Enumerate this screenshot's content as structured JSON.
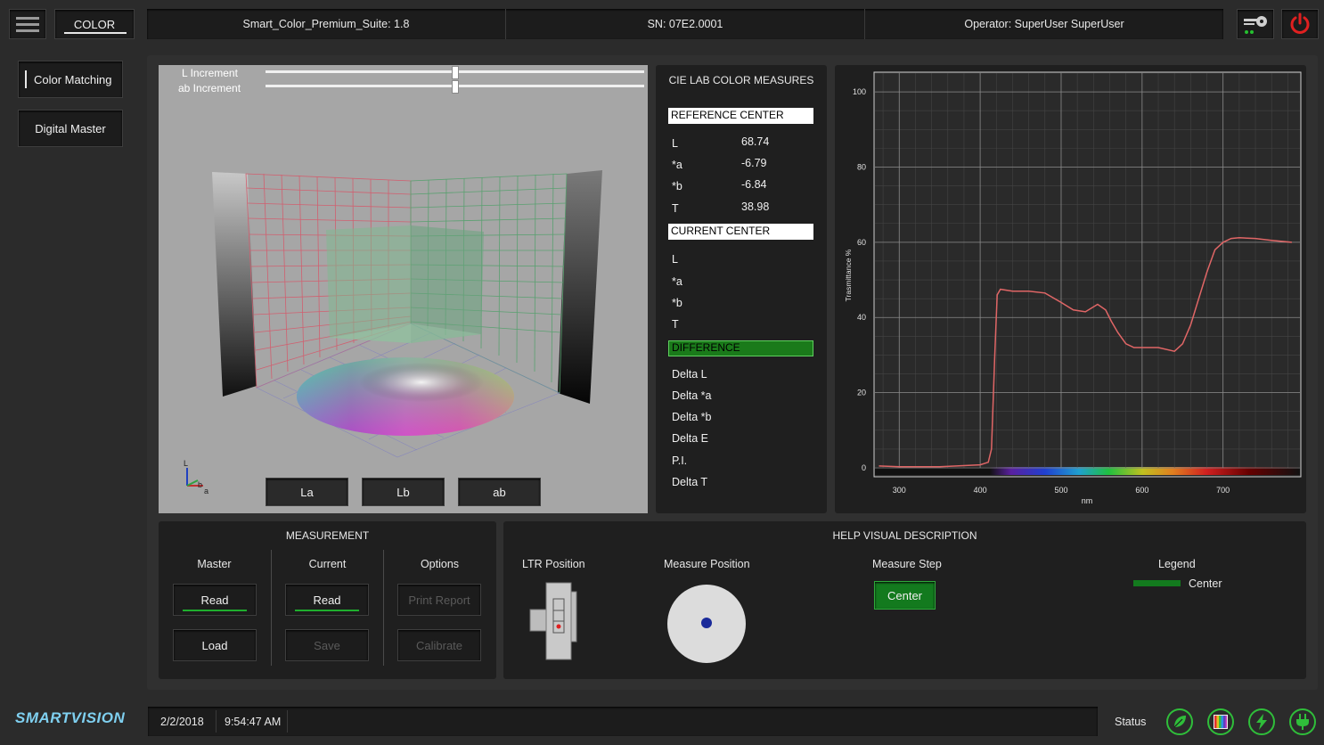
{
  "header": {
    "tab": "COLOR",
    "app_version": "Smart_Color_Premium_Suite: 1.8",
    "serial": "SN: 07E2.0001",
    "operator": "Operator:  SuperUser SuperUser"
  },
  "sidebar": {
    "items": [
      {
        "label": "Color Matching"
      },
      {
        "label": "Digital Master"
      }
    ]
  },
  "viewer": {
    "l_increment_label": "L Increment",
    "ab_increment_label": "ab Increment",
    "l_increment_value": 0.5,
    "ab_increment_value": 0.5,
    "axis_L": "L",
    "axis_a": "a",
    "axis_b": "b",
    "buttons": [
      "La",
      "Lb",
      "ab"
    ]
  },
  "measures": {
    "title": "CIE LAB COLOR MEASURES",
    "reference_header": "REFERENCE CENTER",
    "reference": [
      {
        "label": "L",
        "value": "68.74"
      },
      {
        "label": "*a",
        "value": "-6.79"
      },
      {
        "label": "*b",
        "value": "-6.84"
      },
      {
        "label": "T",
        "value": "38.98"
      }
    ],
    "current_header": "CURRENT CENTER",
    "current": [
      {
        "label": "L",
        "value": ""
      },
      {
        "label": "*a",
        "value": ""
      },
      {
        "label": "*b",
        "value": ""
      },
      {
        "label": "T",
        "value": ""
      }
    ],
    "difference_header": "DIFFERENCE",
    "difference": [
      {
        "label": "Delta L",
        "value": ""
      },
      {
        "label": "Delta *a",
        "value": ""
      },
      {
        "label": "Delta *b",
        "value": ""
      },
      {
        "label": "Delta E",
        "value": ""
      },
      {
        "label": "P.I.",
        "value": ""
      },
      {
        "label": "Delta T",
        "value": ""
      }
    ]
  },
  "chart_data": {
    "type": "line",
    "title": "",
    "xlabel": "nm",
    "ylabel": "Trasmittance %",
    "xlim": [
      270,
      795
    ],
    "ylim": [
      0,
      105
    ],
    "xticks": [
      300,
      400,
      500,
      600,
      700
    ],
    "yticks": [
      0,
      20,
      40,
      60,
      80,
      100
    ],
    "grid": true,
    "series": [
      {
        "color": "#e06666",
        "x": [
          275,
          300,
          350,
          400,
          410,
          414,
          418,
          421,
          425,
          440,
          460,
          480,
          500,
          515,
          530,
          545,
          555,
          562,
          570,
          580,
          590,
          600,
          620,
          640,
          650,
          660,
          670,
          680,
          690,
          700,
          710,
          720,
          740,
          760,
          785
        ],
        "y": [
          0.5,
          0.3,
          0.3,
          0.8,
          1.5,
          5,
          30,
          46,
          47.5,
          47,
          47,
          46.5,
          44,
          42,
          41.5,
          43.5,
          42,
          39,
          36,
          33,
          32,
          32,
          32,
          31,
          33,
          38,
          45,
          52,
          58,
          60,
          61,
          61.2,
          61,
          60.5,
          60
        ]
      }
    ]
  },
  "measurement": {
    "title": "MEASUREMENT",
    "master_label": "Master",
    "current_label": "Current",
    "options_label": "Options",
    "master_read": "Read",
    "master_load": "Load",
    "current_read": "Read",
    "current_save": "Save",
    "print_report": "Print Report",
    "calibrate": "Calibrate"
  },
  "help": {
    "title": "HELP VISUAL DESCRIPTION",
    "ltr_position": "LTR Position",
    "measure_position": "Measure Position",
    "measure_step": "Measure Step",
    "step_button": "Center",
    "legend": "Legend",
    "legend_item": "Center"
  },
  "footer": {
    "logo": "SMARTVISION",
    "date": "2/2/2018",
    "time": "9:54:47 AM",
    "status_label": "Status"
  },
  "colors": {
    "accent_green": "#1fae2e",
    "power_red": "#e02020",
    "curve_red": "#e06666"
  },
  "icons": [
    "menu-icon",
    "key-icon",
    "power-icon",
    "leaf-icon",
    "color-bars-icon",
    "bolt-icon",
    "plug-icon"
  ]
}
